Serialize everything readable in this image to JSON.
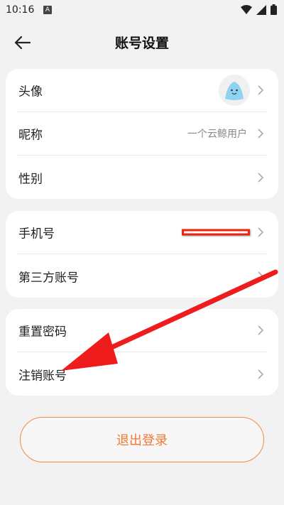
{
  "status_bar": {
    "time": "10:16",
    "notification_letter": "A"
  },
  "header": {
    "title": "账号设置"
  },
  "profile_card": {
    "rows": [
      {
        "label": "头像"
      },
      {
        "label": "昵称",
        "value": "一个云鲸用户"
      },
      {
        "label": "性别"
      }
    ]
  },
  "account_card": {
    "rows": [
      {
        "label": "手机号"
      },
      {
        "label": "第三方账号"
      }
    ]
  },
  "security_card": {
    "rows": [
      {
        "label": "重置密码"
      },
      {
        "label": "注销账号"
      }
    ]
  },
  "logout": {
    "label": "退出登录"
  },
  "colors": {
    "accent": "#f07a33",
    "annotation_arrow": "#ee1c1c",
    "background": "#f2f2f2"
  },
  "icons": [
    "back-arrow-icon",
    "chevron-right-icon",
    "wifi-icon",
    "signal-icon",
    "battery-icon"
  ]
}
